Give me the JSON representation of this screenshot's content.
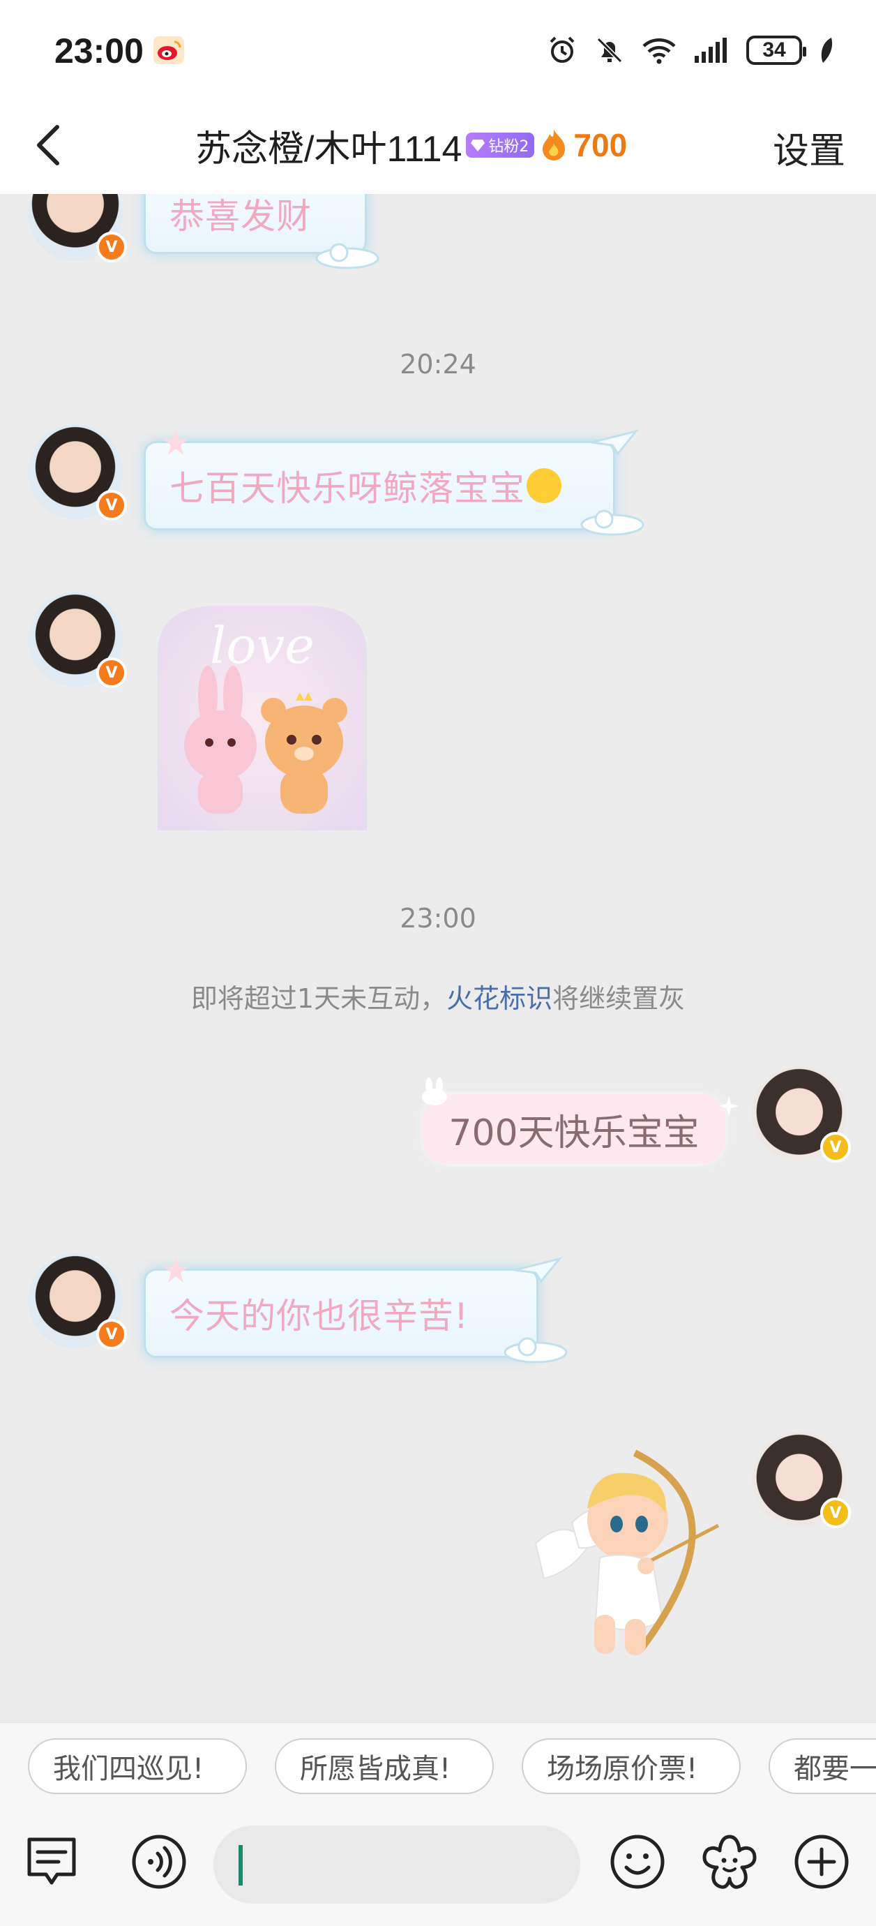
{
  "status_bar": {
    "time": "23:00",
    "battery": "34",
    "icons": [
      "weibo-icon",
      "alarm-icon",
      "mute-icon",
      "wifi-icon",
      "signal-icon",
      "battery-icon",
      "leaf-icon"
    ]
  },
  "header": {
    "back_icon": "chevron-left-icon",
    "title": "苏念橙/木叶1114",
    "fan_badge": "钻粉2",
    "spark_icon": "flame-icon",
    "spark_count": "700",
    "settings_label": "设置"
  },
  "messages": [
    {
      "side": "left",
      "type": "text",
      "text": "恭喜发财"
    },
    {
      "type": "time",
      "text": "20:24"
    },
    {
      "side": "left",
      "type": "text",
      "text": "七百天快乐呀鲸落宝宝"
    },
    {
      "side": "left",
      "type": "sticker",
      "sticker": "love-bunny-bear-sticker"
    },
    {
      "type": "time",
      "text": "23:00"
    },
    {
      "type": "system",
      "pre": "即将超过1天未互动，",
      "highlight": "火花标识",
      "post": "将继续置灰"
    },
    {
      "side": "right",
      "type": "text",
      "text": "700天快乐宝宝"
    },
    {
      "side": "left",
      "type": "text",
      "text": "今天的你也很辛苦!"
    },
    {
      "side": "right",
      "type": "sticker",
      "sticker": "cupid-sticker"
    }
  ],
  "quick_replies": [
    "我们四巡见!",
    "所愿皆成真!",
    "场场原价票!",
    "都要一"
  ],
  "input_bar": {
    "icons": [
      "compose-icon",
      "voice-icon",
      "emoji-icon",
      "sticker-flower-icon",
      "plus-icon"
    ],
    "value": ""
  },
  "colors": {
    "spark": "#f07a12",
    "highlight_link": "#4a6fa8",
    "bubble_text_pink": "#f0a9c0",
    "verified_orange": "#f57b1c",
    "verified_gold": "#f4bd19"
  }
}
